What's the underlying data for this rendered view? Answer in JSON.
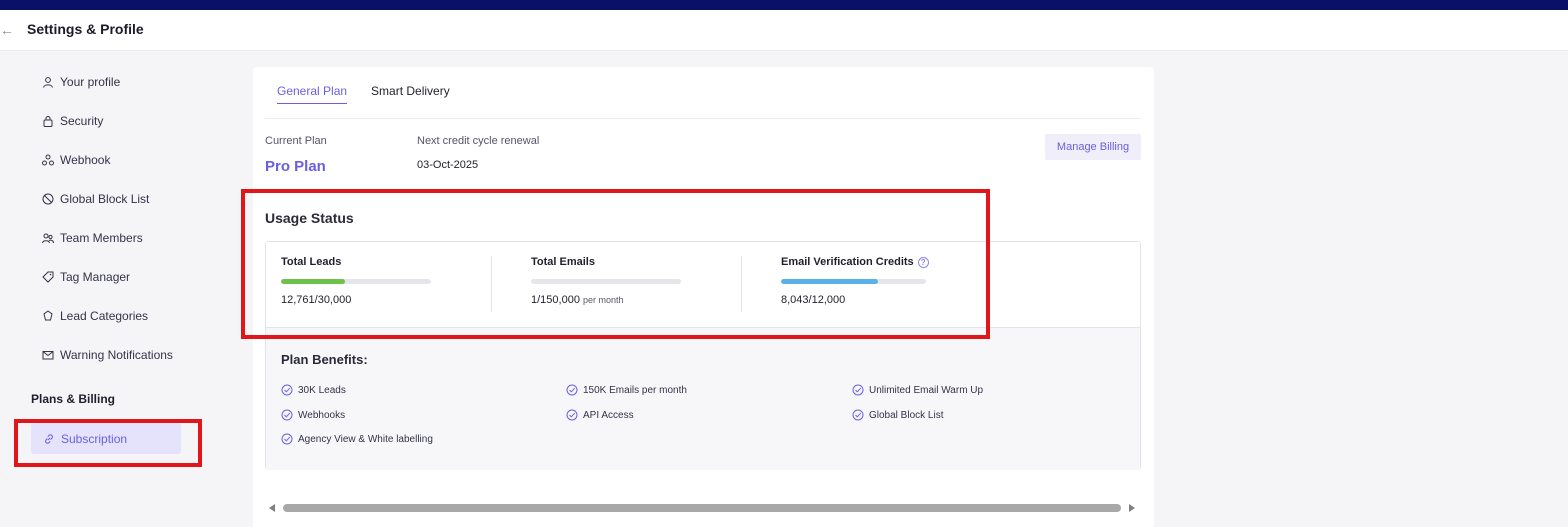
{
  "header": {
    "title": "Settings & Profile",
    "back_icon": "arrow-left-icon"
  },
  "sidebar": {
    "items": [
      {
        "label": "Your profile",
        "icon": "user-icon"
      },
      {
        "label": "Security",
        "icon": "lock-icon"
      },
      {
        "label": "Webhook",
        "icon": "webhook-icon"
      },
      {
        "label": "Global Block List",
        "icon": "block-icon"
      },
      {
        "label": "Team Members",
        "icon": "team-icon"
      },
      {
        "label": "Tag Manager",
        "icon": "tag-icon"
      },
      {
        "label": "Lead Categories",
        "icon": "category-icon"
      },
      {
        "label": "Warning Notifications",
        "icon": "mail-alert-icon"
      }
    ],
    "section_label": "Plans & Billing",
    "active_item": {
      "label": "Subscription",
      "icon": "link-icon"
    }
  },
  "tabs": [
    {
      "label": "General Plan",
      "active": true
    },
    {
      "label": "Smart Delivery",
      "active": false
    }
  ],
  "plan": {
    "current_label": "Current Plan",
    "name": "Pro Plan",
    "renewal_label": "Next credit cycle renewal",
    "renewal_date": "03-Oct-2025",
    "manage_billing": "Manage Billing"
  },
  "usage": {
    "title": "Usage Status",
    "metrics": [
      {
        "title": "Total Leads",
        "value": "12,761/30,000",
        "suffix": "",
        "progress": 0.425,
        "color": "#6cc24a"
      },
      {
        "title": "Total Emails",
        "value": "1/150,000",
        "suffix": "per month",
        "progress": 0.0,
        "color": "#6cc24a"
      },
      {
        "title": "Email Verification Credits",
        "value": "8,043/12,000",
        "suffix": "",
        "progress": 0.67,
        "color": "#5ab0e8"
      }
    ]
  },
  "benefits": {
    "title": "Plan Benefits:",
    "items": [
      "30K Leads",
      "150K Emails per month",
      "Unlimited Email Warm Up",
      "Webhooks",
      "API Access",
      "Global Block List",
      "Agency View & White labelling"
    ]
  },
  "colors": {
    "accent": "#6a5fe0",
    "topbar": "#0a1066",
    "highlight": "#e0161a"
  }
}
